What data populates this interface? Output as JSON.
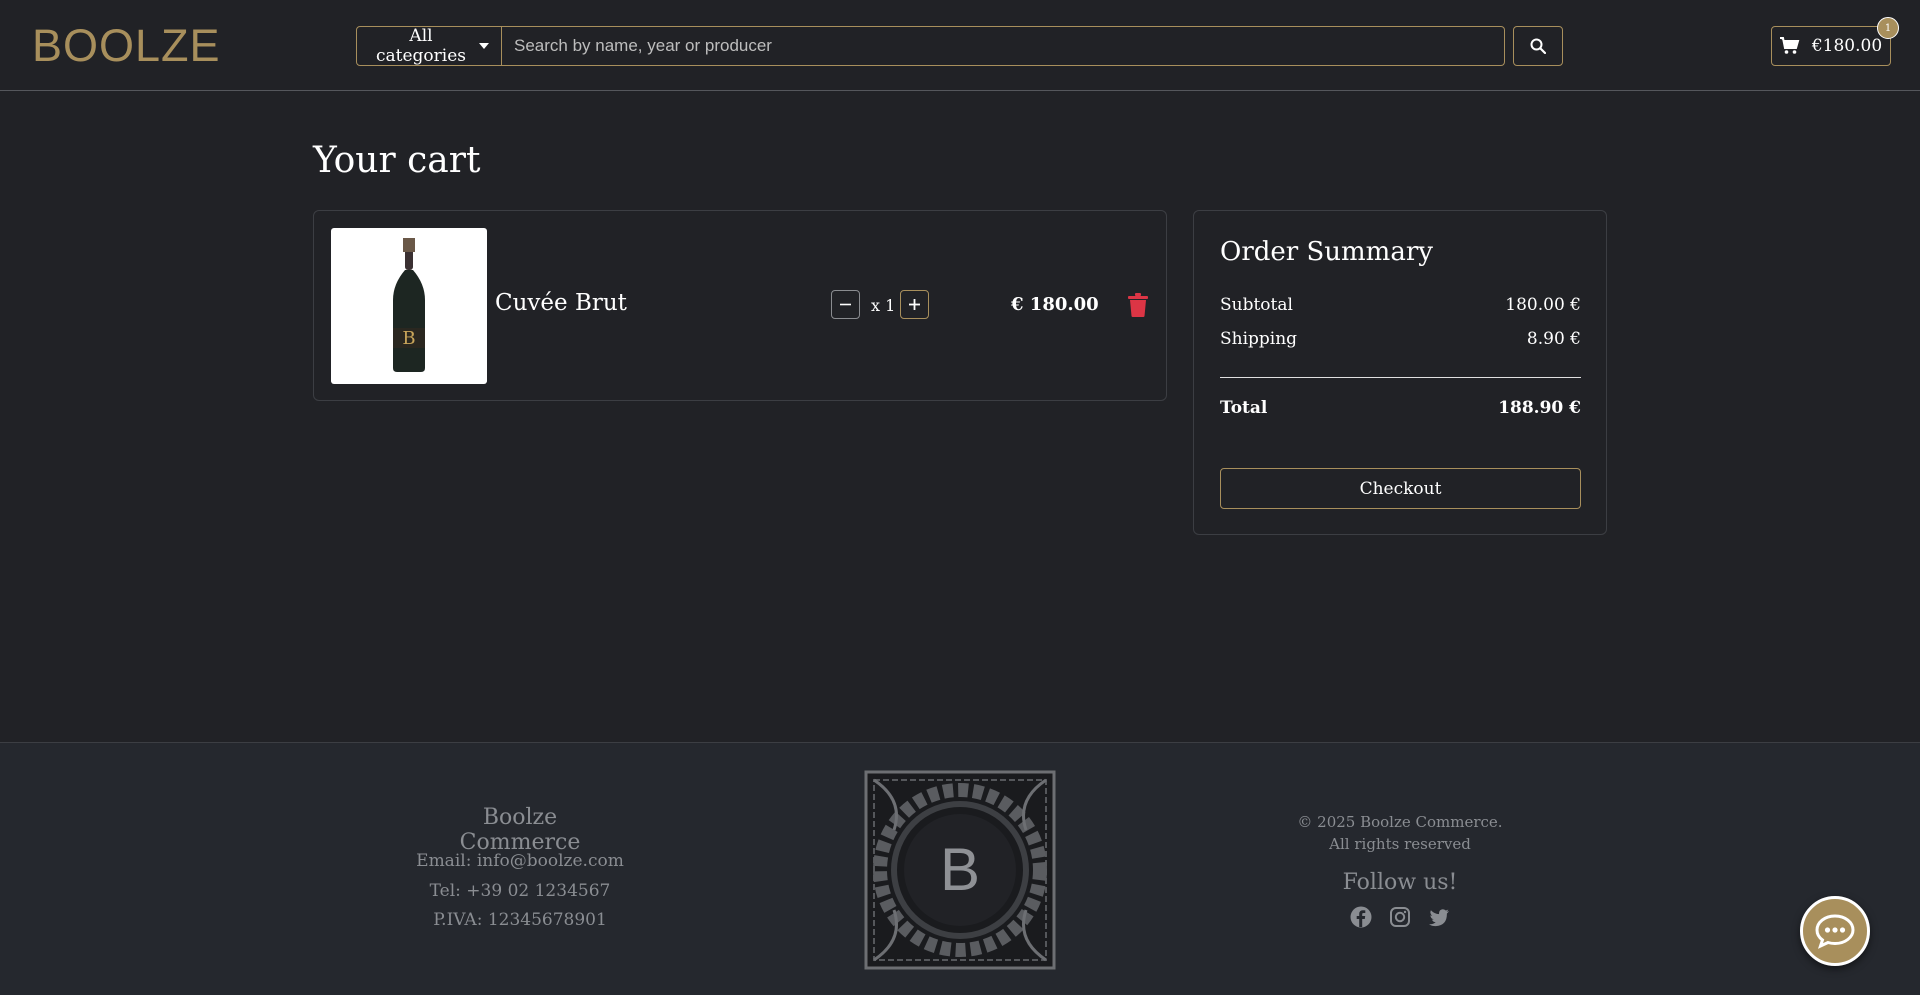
{
  "header": {
    "logo": "BOOLZE",
    "category_button": "All categories",
    "search_placeholder": "Search by name, year or producer",
    "cart_total": "€180.00",
    "cart_count": "1"
  },
  "main": {
    "title": "Your cart",
    "items": [
      {
        "name": "Cuvée Brut",
        "quantity": "x 1",
        "price": "€ 180.00"
      }
    ]
  },
  "summary": {
    "title": "Order Summary",
    "subtotal_label": "Subtotal",
    "subtotal_value": "180.00 €",
    "shipping_label": "Shipping",
    "shipping_value": "8.90 €",
    "total_label": "Total",
    "total_value": "188.90 €",
    "checkout_label": "Checkout"
  },
  "footer": {
    "brand": "Boolze Commerce",
    "email": "Email: info@boolze.com",
    "tel": "Tel: +39 02 1234567",
    "piva": "P.IVA: 12345678901",
    "logo_letter": "B",
    "copyright_line1": "© 2025 Boolze Commerce.",
    "copyright_line2": "All rights reserved",
    "follow": "Follow us!",
    "social": [
      "facebook-icon",
      "instagram-icon",
      "twitter-icon"
    ]
  },
  "colors": {
    "background": "#212226",
    "accent_gold": "#a88f5c",
    "danger": "#dc3545",
    "footer_bg": "#25282e"
  }
}
